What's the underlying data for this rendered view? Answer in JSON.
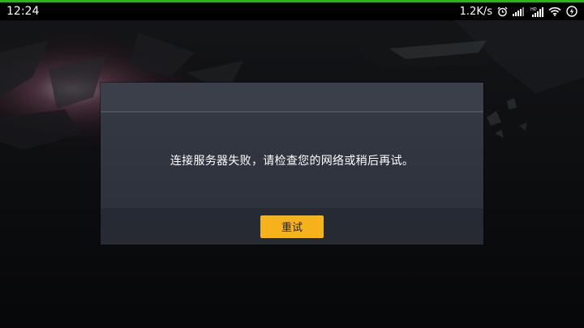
{
  "status_bar": {
    "time": "12:24",
    "net_speed": "1.2K/s",
    "icons": [
      "alarm-icon",
      "signal-icon",
      "hd-signal-icon",
      "wifi-icon",
      "battery-charging-icon"
    ]
  },
  "dialog": {
    "message": "连接服务器失败，请检查您的网络或稍后再试。",
    "retry_label": "重试"
  },
  "colors": {
    "accent": "#2bb51c",
    "button": "#f5b21a",
    "dialog_bg": "#2b303a"
  }
}
